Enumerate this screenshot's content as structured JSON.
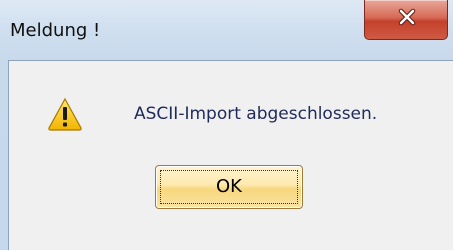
{
  "window": {
    "title": "Meldung !",
    "close_icon": "close-icon"
  },
  "dialog": {
    "icon": "warning-icon",
    "message": "ASCII-Import abgeschlossen.",
    "ok_label": "OK"
  },
  "colors": {
    "frame": "#c8d9ec",
    "client": "#f0f0f0",
    "message_text": "#1f2a5a",
    "close_button": "#c4412c",
    "ok_button": "#f7d77e"
  }
}
